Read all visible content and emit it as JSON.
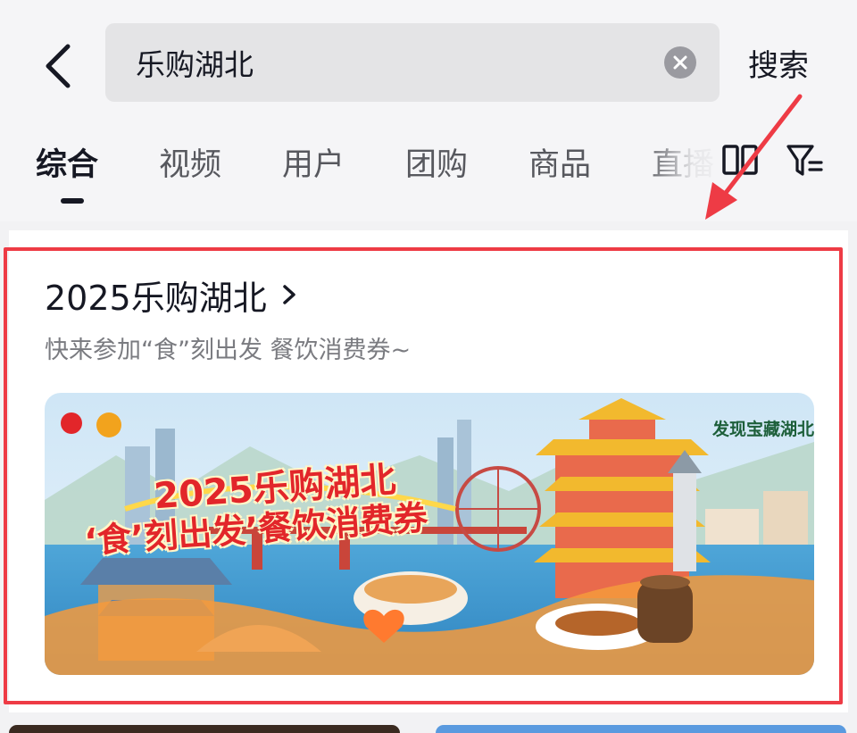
{
  "search": {
    "query": "乐购湖北",
    "submit_label": "搜索"
  },
  "tabs": [
    {
      "label": "综合",
      "active": true
    },
    {
      "label": "视频",
      "active": false
    },
    {
      "label": "用户",
      "active": false
    },
    {
      "label": "团购",
      "active": false
    },
    {
      "label": "商品",
      "active": false
    },
    {
      "label": "直播",
      "active": false
    }
  ],
  "icons": {
    "back": "back-chevron-icon",
    "clear": "clear-circle-icon",
    "layout": "double-column-layout-icon",
    "filter": "filter-funnel-icon",
    "title_chevron": "chevron-right-icon"
  },
  "result_card": {
    "title": "2025乐购湖北",
    "subtitle": "快来参加“食”刻出发  餐饮消费券~",
    "banner": {
      "headline": "2025乐购湖北",
      "subheadline": "‘食’刻出发’餐饮消费券",
      "brand_text": "发现宝藏湖北"
    }
  },
  "colors": {
    "highlight": "#ee3b45",
    "banner_title": "#e2262a",
    "active_tab": "#161823",
    "inactive_tab": "#57585e"
  }
}
